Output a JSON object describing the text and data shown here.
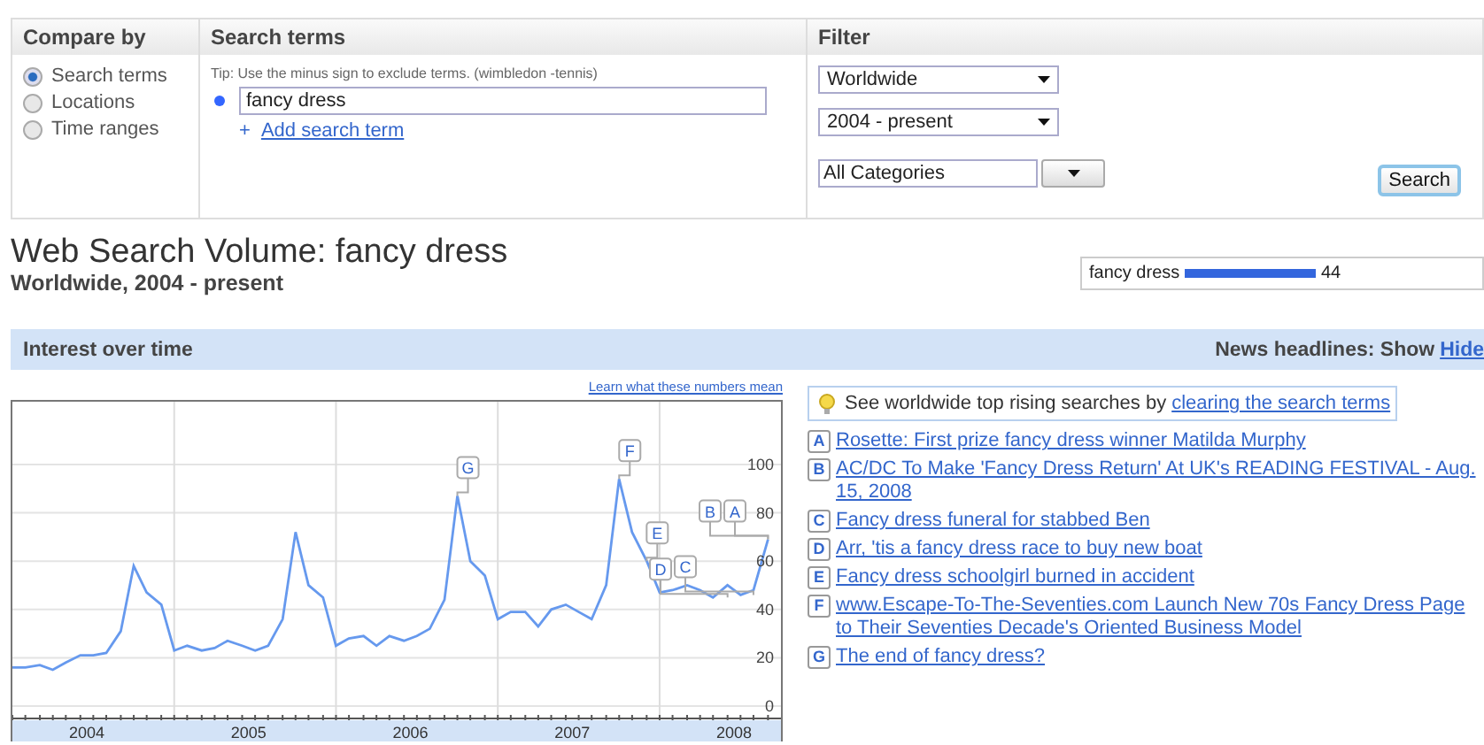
{
  "compare_by": {
    "heading": "Compare by",
    "options": [
      {
        "label": "Search terms",
        "selected": true
      },
      {
        "label": "Locations",
        "selected": false
      },
      {
        "label": "Time ranges",
        "selected": false
      }
    ]
  },
  "search_terms": {
    "heading": "Search terms",
    "tip": "Tip: Use the minus sign to exclude terms. (wimbledon -tennis)",
    "terms": [
      {
        "value": "fancy dress",
        "color": "#3366ff"
      }
    ],
    "add_icon": "+",
    "add_link": "Add search term"
  },
  "filter": {
    "heading": "Filter",
    "selects": [
      {
        "value": "Worldwide"
      },
      {
        "value": "2004 - present"
      }
    ],
    "category": {
      "value": "All Categories"
    },
    "search_button": "Search"
  },
  "title": "Web Search Volume: fancy dress",
  "subtitle": "Worldwide, 2004 - present",
  "term_bar": {
    "label": "fancy dress",
    "level": 0.44,
    "reading": "44"
  },
  "interest_heading": "Interest over time",
  "news_toggle": {
    "label": "News headlines: Show",
    "hide": "Hide"
  },
  "learn_link": "Learn what these numbers mean",
  "chart_data": {
    "type": "line",
    "grid": true,
    "x": [
      2003.54,
      2003.62,
      2003.71,
      2003.79,
      2003.87,
      2003.96,
      2004.04,
      2004.12,
      2004.21,
      2004.29,
      2004.37,
      2004.46,
      2004.54,
      2004.62,
      2004.71,
      2004.79,
      2004.87,
      2004.96,
      2005.04,
      2005.12,
      2005.21,
      2005.29,
      2005.37,
      2005.46,
      2005.54,
      2005.62,
      2005.71,
      2005.79,
      2005.87,
      2005.96,
      2006.04,
      2006.12,
      2006.21,
      2006.29,
      2006.37,
      2006.46,
      2006.54,
      2006.62,
      2006.71,
      2006.79,
      2006.87,
      2006.96,
      2007.04,
      2007.12,
      2007.21,
      2007.29,
      2007.37,
      2007.46,
      2007.54,
      2007.62,
      2007.71,
      2007.79,
      2007.87,
      2007.96,
      2008.04,
      2008.12,
      2008.21
    ],
    "series": [
      {
        "color": "#6699ee",
        "values": [
          16,
          16,
          17,
          15,
          18,
          21,
          21,
          22,
          31,
          58,
          47,
          42,
          23,
          25,
          23,
          24,
          27,
          25,
          23,
          25,
          36,
          72,
          50,
          45,
          25,
          28,
          29,
          25,
          29,
          27,
          29,
          32,
          44,
          87,
          60,
          54,
          36,
          39,
          39,
          33,
          40,
          42,
          39,
          36,
          50,
          94,
          72,
          60,
          47,
          48,
          50,
          48,
          45,
          50,
          46,
          48,
          69
        ]
      }
    ],
    "xlim": [
      2003.54,
      2008.29
    ],
    "ylim": [
      0,
      126
    ],
    "xticks": [
      2004,
      2005,
      2006,
      2007,
      2008
    ],
    "yticks": [
      0,
      20,
      40,
      60,
      80,
      100
    ],
    "annotations": [
      {
        "x": 2006.29,
        "y": 87,
        "text": "G"
      },
      {
        "x": 2007.29,
        "y": 94,
        "text": "F"
      },
      {
        "x": 2007.46,
        "y": 60,
        "text": "E"
      },
      {
        "x": 2007.96,
        "y": 45,
        "text": "D"
      },
      {
        "x": 2008.12,
        "y": 46,
        "text": "C"
      },
      {
        "x": 2008.21,
        "y": 69,
        "text": "B"
      },
      {
        "x": 2008.21,
        "y": 69,
        "text": "A"
      }
    ]
  },
  "tip_box": {
    "text": "See worldwide top rising searches by",
    "link": "clearing the search terms"
  },
  "news": [
    {
      "letter": "A",
      "title": "Rosette: First prize fancy dress winner Matilda Murphy"
    },
    {
      "letter": "B",
      "title": "AC/DC To Make 'Fancy Dress Return' At UK's READING FESTIVAL - Aug. 15, 2008"
    },
    {
      "letter": "C",
      "title": "Fancy dress funeral for stabbed Ben"
    },
    {
      "letter": "D",
      "title": "Arr, 'tis a fancy dress race to buy new boat"
    },
    {
      "letter": "E",
      "title": "Fancy dress schoolgirl burned in accident"
    },
    {
      "letter": "F",
      "title": "www.Escape-To-The-Seventies.com Launch New 70s Fancy Dress Page to Their Seventies Decade's Oriented Business Model"
    },
    {
      "letter": "G",
      "title": "The end of fancy dress?"
    }
  ]
}
